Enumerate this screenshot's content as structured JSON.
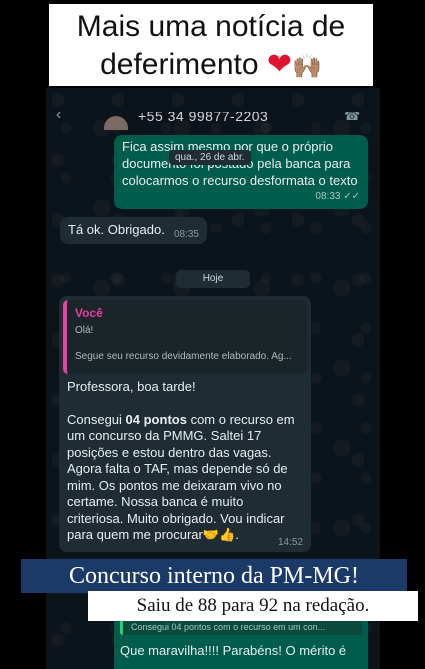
{
  "title_card": {
    "line1": "Mais uma notícia de",
    "line2": "deferimento",
    "heart": "❤",
    "hands": "🙌🏽"
  },
  "header": {
    "phone": "+55 34 99877-2203",
    "back_label": "‹",
    "call_icon": "☎"
  },
  "messages": {
    "outgoing_top": {
      "text": "Fica assim mesmo por que o próprio documento foi postado pela banca para colocarmos o recurso desformata o texto",
      "time": "08:33",
      "ticks": "✓✓"
    },
    "date_pill": "qua., 26 de abr.",
    "incoming_small": {
      "text": "Tá ok. Obrigado.",
      "time": "08:35"
    },
    "today_pill": "Hoje",
    "incoming_big": {
      "quote_author": "Você",
      "quote_line1": "Olá!",
      "quote_line2": "Segue seu recurso devidamente elaborado. Ag...",
      "greeting": "Professora, boa tarde!",
      "body_pre": "Consegui ",
      "body_bold": "04 pontos",
      "body_post": " com o recurso em um concurso da PMMG. Saltei 17 posições e estou dentro das vagas. Agora falta o TAF, mas depende só de mim. Os pontos me deixaram vivo no certame. Nossa banca é muito criteriosa. Muito obrigado. Vou indicar para quem me procurar",
      "emoji": "🤝👍",
      "time": "14:52"
    }
  },
  "captions": {
    "blue": "Concurso interno da PM-MG!",
    "white": "Saiu de 88 para 92 na redação."
  },
  "bottom_bubble": {
    "quote": "Consegui 04 pontos com o recurso em um con...",
    "text": "Que maravilha!!!! Parabéns! O mérito é"
  },
  "colors": {
    "bubble_out": "#005c4b",
    "bubble_in": "#202c33",
    "chat_bg": "#0b141a",
    "caption_blue": "#1c3a68",
    "quote_accent": "#e542a3"
  }
}
